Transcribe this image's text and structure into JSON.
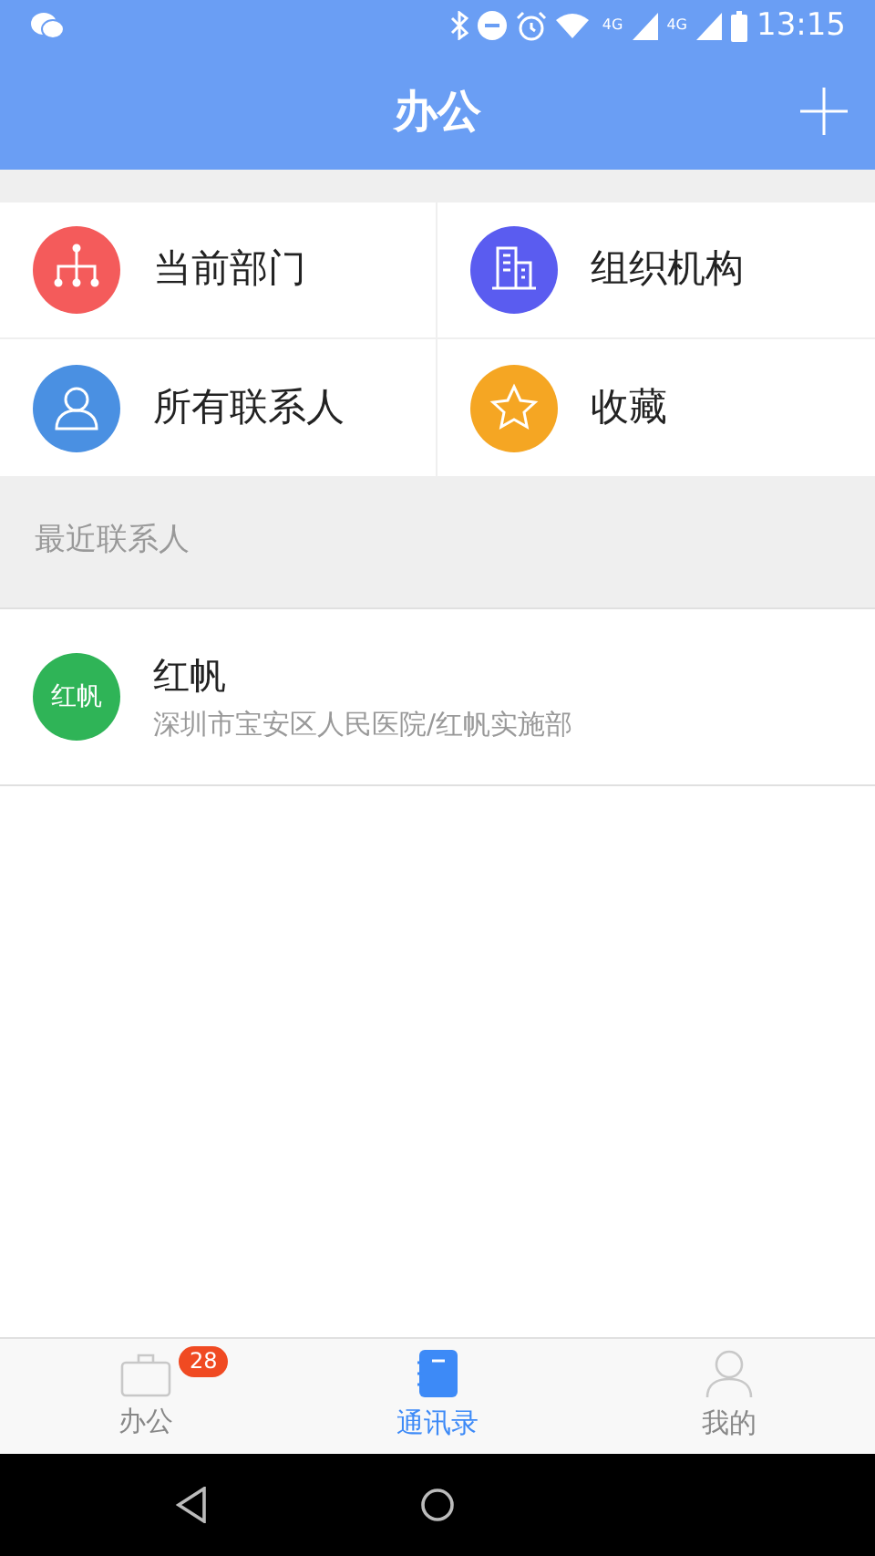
{
  "status_bar": {
    "time": "13:15",
    "network_1": "4G",
    "network_2": "4G"
  },
  "header": {
    "title": "办公"
  },
  "shortcuts": [
    {
      "label": "当前部门",
      "kind": "department",
      "color": "#f45b5b"
    },
    {
      "label": "组织机构",
      "kind": "organization",
      "color": "#5a5cf0"
    },
    {
      "label": "所有联系人",
      "kind": "contacts",
      "color": "#4a90e2"
    },
    {
      "label": "收藏",
      "kind": "favorites",
      "color": "#f5a623"
    }
  ],
  "recent": {
    "heading": "最近联系人",
    "contacts": [
      {
        "avatar": "红帆",
        "name": "红帆",
        "detail": "深圳市宝安区人民医院/红帆实施部",
        "color": "#2fb457"
      }
    ]
  },
  "tab_bar": [
    {
      "label": "办公",
      "kind": "briefcase",
      "badge": "28",
      "selected": false
    },
    {
      "label": "通讯录",
      "kind": "notebook",
      "selected": true
    },
    {
      "label": "我的",
      "kind": "person",
      "selected": false
    }
  ]
}
